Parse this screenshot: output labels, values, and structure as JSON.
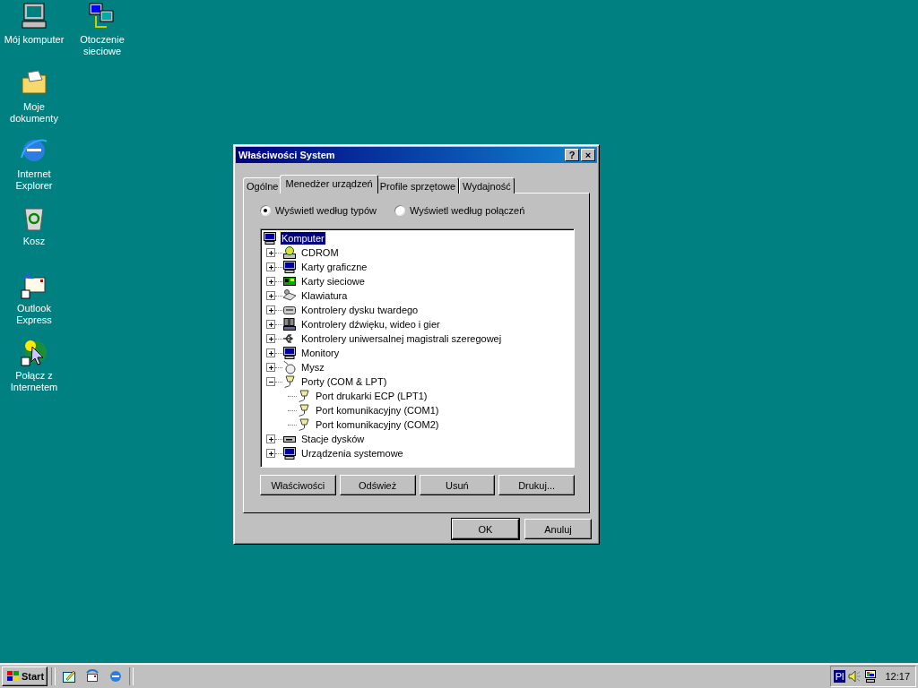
{
  "desktop_icons": [
    {
      "kind": "computer",
      "label": "Mój komputer"
    },
    {
      "kind": "network",
      "label": "Otoczenie sieciowe"
    },
    {
      "kind": "folder",
      "label": "Moje dokumenty"
    },
    {
      "kind": "ie",
      "label": "Internet Explorer"
    },
    {
      "kind": "bin",
      "label": "Kosz"
    },
    {
      "kind": "mail",
      "label": "Outlook Express"
    },
    {
      "kind": "connect",
      "label": "Połącz z Internetem"
    }
  ],
  "window": {
    "title": "Właściwości System",
    "help_button": "?",
    "close_button": "×"
  },
  "tabs": [
    {
      "label": "Ogólne",
      "selected": false
    },
    {
      "label": "Menedżer urządzeń",
      "selected": true
    },
    {
      "label": "Profile sprzętowe",
      "selected": false
    },
    {
      "label": "Wydajność",
      "selected": false
    }
  ],
  "view_options": [
    {
      "label": "Wyświetl według typów",
      "selected": true
    },
    {
      "label": "Wyświetl według połączeń",
      "selected": false
    }
  ],
  "tree": {
    "label": "Komputer",
    "kind": "computer",
    "selected": true,
    "children": [
      {
        "label": "CDROM",
        "kind": "cdrom",
        "expanded": false,
        "selected": false
      },
      {
        "label": "Karty graficzne",
        "kind": "monitor",
        "expanded": false,
        "selected": false
      },
      {
        "label": "Karty sieciowe",
        "kind": "card",
        "expanded": false,
        "selected": false
      },
      {
        "label": "Klawiatura",
        "kind": "keyboard",
        "expanded": false,
        "selected": false
      },
      {
        "label": "Kontrolery dysku twardego",
        "kind": "disk",
        "expanded": false,
        "selected": false
      },
      {
        "label": "Kontrolery dźwięku, wideo i gier",
        "kind": "sound",
        "expanded": false,
        "selected": false
      },
      {
        "label": "Kontrolery uniwersalnej magistrali szeregowej",
        "kind": "usb",
        "expanded": false,
        "selected": false
      },
      {
        "label": "Monitory",
        "kind": "monitor",
        "expanded": false,
        "selected": false
      },
      {
        "label": "Mysz",
        "kind": "mouse",
        "expanded": false,
        "selected": false
      },
      {
        "label": "Porty (COM & LPT)",
        "kind": "port",
        "expanded": true,
        "selected": false,
        "children": [
          {
            "label": "Port drukarki ECP (LPT1)",
            "kind": "port",
            "selected": false
          },
          {
            "label": "Port komunikacyjny (COM1)",
            "kind": "port",
            "selected": false
          },
          {
            "label": "Port komunikacyjny (COM2)",
            "kind": "port",
            "selected": false
          }
        ]
      },
      {
        "label": "Stacje dysków",
        "kind": "drive",
        "expanded": false,
        "selected": false
      },
      {
        "label": "Urządzenia systemowe",
        "kind": "computer",
        "expanded": false,
        "selected": false
      }
    ]
  },
  "device_buttons": [
    "Właściwości",
    "Odśwież",
    "Usuń",
    "Drukuj..."
  ],
  "dialog_buttons": [
    {
      "label": "OK",
      "default": true
    },
    {
      "label": "Anuluj",
      "default": false
    }
  ],
  "taskbar": {
    "start": "Start",
    "quick_launch": [
      {
        "kind": "desktop"
      },
      {
        "kind": "channels"
      },
      {
        "kind": "ie"
      }
    ],
    "language": "Pl",
    "clock": "12:17"
  }
}
